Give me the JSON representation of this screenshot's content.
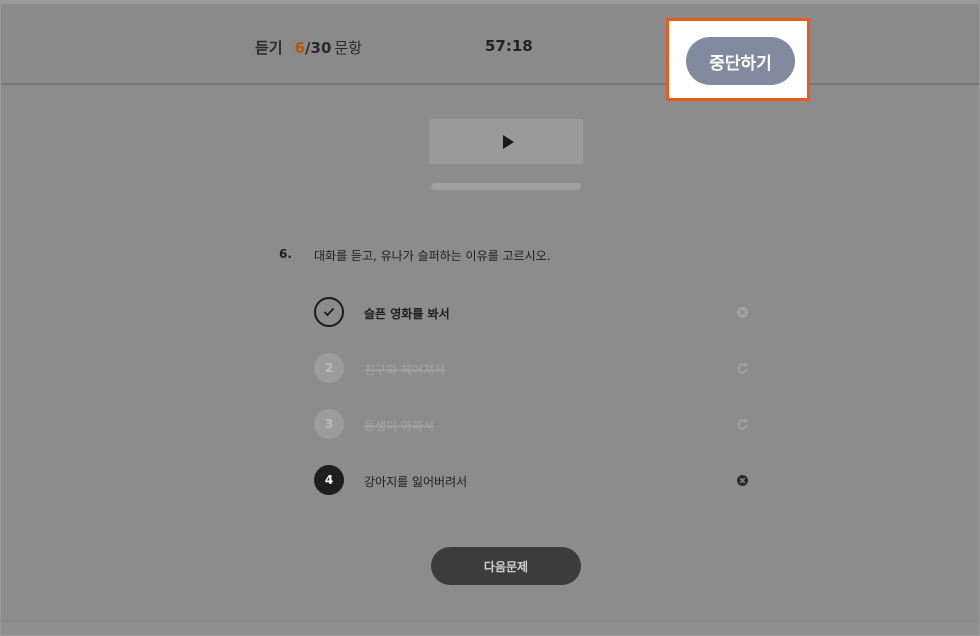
{
  "header": {
    "section_label": "듣기",
    "current": "6",
    "separator": "/",
    "total": "30",
    "unit": "문항",
    "timer": "57:18",
    "stop_button": "중단하기"
  },
  "player": {
    "play_icon": "play-icon"
  },
  "question": {
    "number": "6.",
    "text": "대화를 듣고, 유나가 슬퍼하는 이유를 고르시오."
  },
  "options": [
    {
      "marker": "",
      "text": "슬픈 영화를 봐서",
      "state": "selected",
      "action_icon": "remove-circle-icon"
    },
    {
      "marker": "2",
      "text": "친구와 헤어져서",
      "state": "eliminated",
      "action_icon": "restore-icon"
    },
    {
      "marker": "3",
      "text": "동생이 아파서",
      "state": "eliminated",
      "action_icon": "restore-icon"
    },
    {
      "marker": "4",
      "text": "강아지를 잃어버려서",
      "state": "normal",
      "action_icon": "remove-circle-icon"
    }
  ],
  "next_button": "다음문제",
  "colors": {
    "accent_number": "#b5560c",
    "highlight_border": "#ea5a1e",
    "stop_button_bg": "#828aa0",
    "overlay": "#8c8c8c"
  }
}
